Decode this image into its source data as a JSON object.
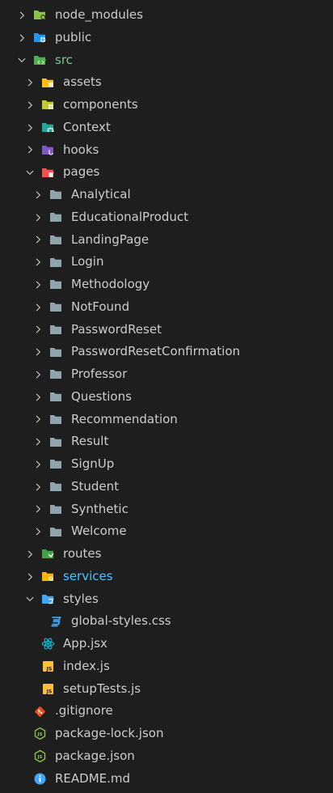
{
  "explorer": {
    "items": [
      {
        "label": "node_modules",
        "depth": 0,
        "type": "folder",
        "expanded": false,
        "icon": "node-modules-folder-icon",
        "color": "#8bc34a"
      },
      {
        "label": "public",
        "depth": 0,
        "type": "folder",
        "expanded": false,
        "icon": "public-folder-icon",
        "color": "#2196f3"
      },
      {
        "label": "src",
        "depth": 0,
        "type": "folder",
        "expanded": true,
        "icon": "src-folder-open-icon",
        "color": "#4caf50",
        "labelColor": "#73c991"
      },
      {
        "label": "assets",
        "depth": 1,
        "type": "folder",
        "expanded": false,
        "icon": "assets-folder-icon",
        "color": "#ffc107"
      },
      {
        "label": "components",
        "depth": 1,
        "type": "folder",
        "expanded": false,
        "icon": "components-folder-icon",
        "color": "#c0ca33"
      },
      {
        "label": "Context",
        "depth": 1,
        "type": "folder",
        "expanded": false,
        "icon": "context-folder-icon",
        "color": "#26a69a"
      },
      {
        "label": "hooks",
        "depth": 1,
        "type": "folder",
        "expanded": false,
        "icon": "hooks-folder-icon",
        "color": "#7e57c2"
      },
      {
        "label": "pages",
        "depth": 1,
        "type": "folder",
        "expanded": true,
        "icon": "pages-folder-open-icon",
        "color": "#ef5350"
      },
      {
        "label": "Analytical",
        "depth": 2,
        "type": "folder",
        "expanded": false,
        "icon": "folder-icon",
        "color": "#90a4ae"
      },
      {
        "label": "EducationalProduct",
        "depth": 2,
        "type": "folder",
        "expanded": false,
        "icon": "folder-icon",
        "color": "#90a4ae"
      },
      {
        "label": "LandingPage",
        "depth": 2,
        "type": "folder",
        "expanded": false,
        "icon": "folder-icon",
        "color": "#90a4ae"
      },
      {
        "label": "Login",
        "depth": 2,
        "type": "folder",
        "expanded": false,
        "icon": "folder-icon",
        "color": "#90a4ae"
      },
      {
        "label": "Methodology",
        "depth": 2,
        "type": "folder",
        "expanded": false,
        "icon": "folder-icon",
        "color": "#90a4ae"
      },
      {
        "label": "NotFound",
        "depth": 2,
        "type": "folder",
        "expanded": false,
        "icon": "folder-icon",
        "color": "#90a4ae"
      },
      {
        "label": "PasswordReset",
        "depth": 2,
        "type": "folder",
        "expanded": false,
        "icon": "folder-icon",
        "color": "#90a4ae"
      },
      {
        "label": "PasswordResetConfirmation",
        "depth": 2,
        "type": "folder",
        "expanded": false,
        "icon": "folder-icon",
        "color": "#90a4ae"
      },
      {
        "label": "Professor",
        "depth": 2,
        "type": "folder",
        "expanded": false,
        "icon": "folder-icon",
        "color": "#90a4ae"
      },
      {
        "label": "Questions",
        "depth": 2,
        "type": "folder",
        "expanded": false,
        "icon": "folder-icon",
        "color": "#90a4ae"
      },
      {
        "label": "Recommendation",
        "depth": 2,
        "type": "folder",
        "expanded": false,
        "icon": "folder-icon",
        "color": "#90a4ae"
      },
      {
        "label": "Result",
        "depth": 2,
        "type": "folder",
        "expanded": false,
        "icon": "folder-icon",
        "color": "#90a4ae"
      },
      {
        "label": "SignUp",
        "depth": 2,
        "type": "folder",
        "expanded": false,
        "icon": "folder-icon",
        "color": "#90a4ae"
      },
      {
        "label": "Student",
        "depth": 2,
        "type": "folder",
        "expanded": false,
        "icon": "folder-icon",
        "color": "#90a4ae"
      },
      {
        "label": "Synthetic",
        "depth": 2,
        "type": "folder",
        "expanded": false,
        "icon": "folder-icon",
        "color": "#90a4ae"
      },
      {
        "label": "Welcome",
        "depth": 2,
        "type": "folder",
        "expanded": false,
        "icon": "folder-icon",
        "color": "#90a4ae"
      },
      {
        "label": "routes",
        "depth": 1,
        "type": "folder",
        "expanded": false,
        "icon": "routes-folder-icon",
        "color": "#43a047"
      },
      {
        "label": "services",
        "depth": 1,
        "type": "folder",
        "expanded": false,
        "icon": "services-folder-icon",
        "color": "#ffb300",
        "labelColor": "#4fc1ff"
      },
      {
        "label": "styles",
        "depth": 1,
        "type": "folder",
        "expanded": true,
        "icon": "styles-folder-open-icon",
        "color": "#42a5f5"
      },
      {
        "label": "global-styles.css",
        "depth": 2,
        "type": "file",
        "icon": "css-file-icon",
        "color": "#42a5f5"
      },
      {
        "label": "App.jsx",
        "depth": 1,
        "type": "file",
        "icon": "react-file-icon",
        "color": "#00bcd4"
      },
      {
        "label": "index.js",
        "depth": 1,
        "type": "file",
        "icon": "js-file-icon",
        "color": "#fbc02d"
      },
      {
        "label": "setupTests.js",
        "depth": 1,
        "type": "file",
        "icon": "js-file-icon",
        "color": "#fbc02d"
      },
      {
        "label": ".gitignore",
        "depth": 0,
        "type": "file",
        "icon": "git-file-icon",
        "color": "#e64a19"
      },
      {
        "label": "package-lock.json",
        "depth": 0,
        "type": "file",
        "icon": "nodejs-file-icon",
        "color": "#8bc34a"
      },
      {
        "label": "package.json",
        "depth": 0,
        "type": "file",
        "icon": "nodejs-file-icon",
        "color": "#8bc34a"
      },
      {
        "label": "README.md",
        "depth": 0,
        "type": "file",
        "icon": "info-file-icon",
        "color": "#42a5f5"
      }
    ]
  }
}
